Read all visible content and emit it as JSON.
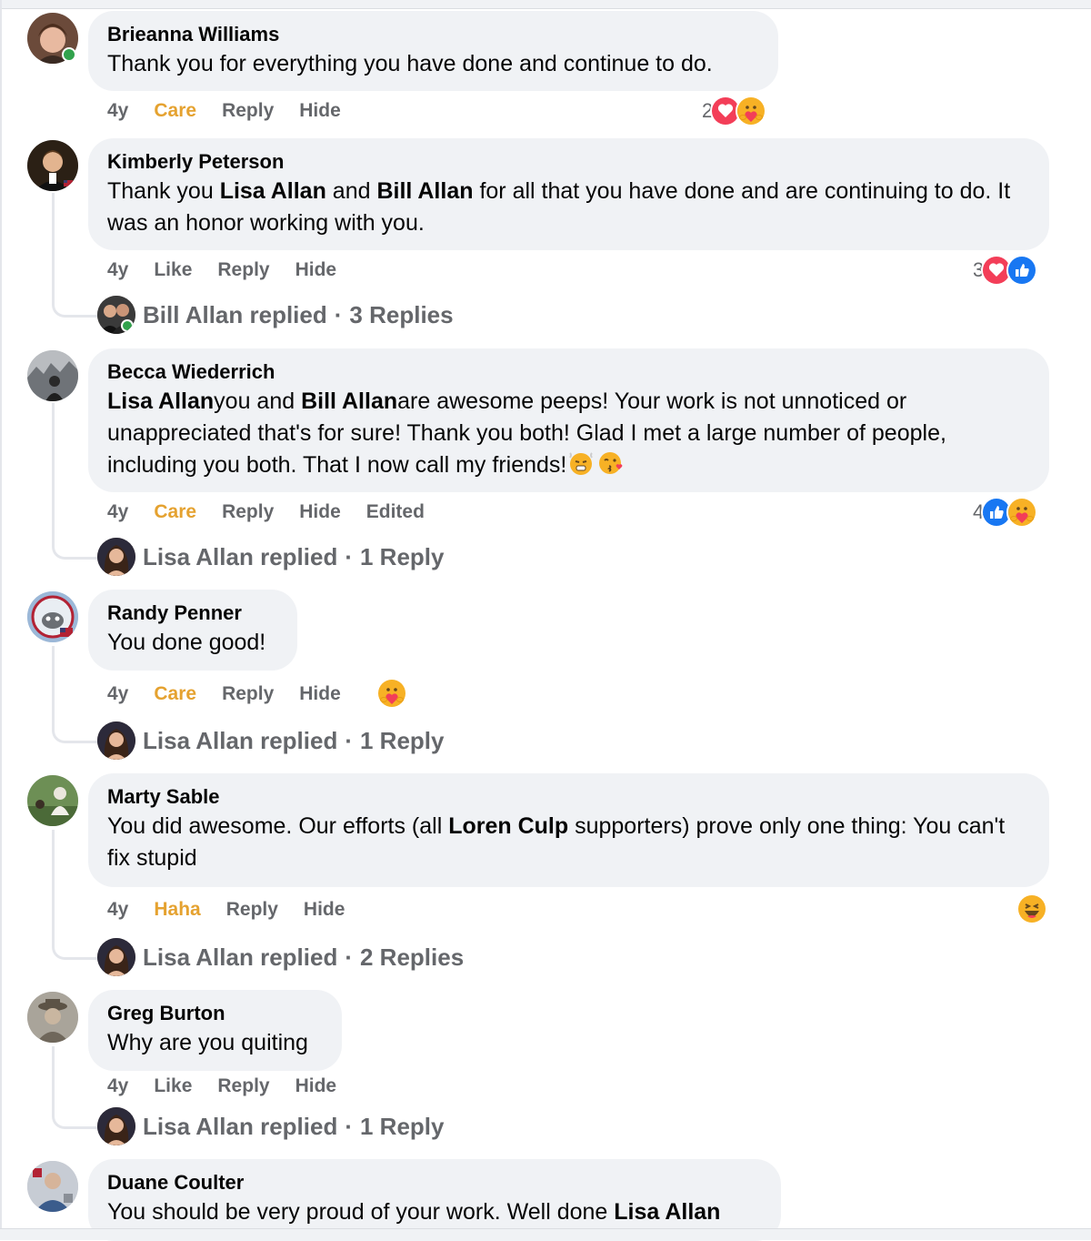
{
  "comments": [
    {
      "author": "Brieanna Williams",
      "text_parts": [
        "Thank you for everything you have done and continue to do."
      ],
      "time": "4y",
      "reaction_label": "Care",
      "reply_label": "Reply",
      "hide_label": "Hide",
      "reaction_count": "2",
      "reaction_icons": [
        "love-icon",
        "care-icon"
      ]
    },
    {
      "author": "Kimberly Peterson",
      "text_parts": [
        "Thank you ",
        "Lisa Allan",
        " and ",
        "Bill Allan",
        " for all that you have done and are continuing to do. It was an honor working with you."
      ],
      "time": "4y",
      "reaction_label": "Like",
      "reply_label": "Reply",
      "hide_label": "Hide",
      "reaction_count": "3",
      "reaction_icons": [
        "love-icon",
        "like-icon"
      ],
      "replied": {
        "who": "Bill Allan replied",
        "sep": "·",
        "count": "3 Replies"
      }
    },
    {
      "author": "Becca Wiederrich",
      "text_parts": [
        "Lisa Allan",
        "you and ",
        "Bill Allan",
        "are awesome peeps! Your work is not unnoticed or unappreciated that's for sure! Thank you both! Glad I met a large number of people, including you both. That I now call my friends!"
      ],
      "time": "4y",
      "reaction_label": "Care",
      "reply_label": "Reply",
      "hide_label": "Hide",
      "edited_label": "Edited",
      "reaction_count": "4",
      "reaction_icons": [
        "like-icon",
        "care-icon"
      ],
      "replied": {
        "who": "Lisa Allan replied",
        "sep": "·",
        "count": "1 Reply"
      }
    },
    {
      "author": "Randy Penner",
      "text_parts": [
        "You done good!"
      ],
      "time": "4y",
      "reaction_label": "Care",
      "reply_label": "Reply",
      "hide_label": "Hide",
      "reaction_icons": [
        "care-icon"
      ],
      "replied": {
        "who": "Lisa Allan replied",
        "sep": "·",
        "count": "1 Reply"
      }
    },
    {
      "author": "Marty Sable",
      "text_parts": [
        "You did awesome. Our efforts (all ",
        "Loren Culp",
        " supporters) prove only one thing: You can't fix stupid"
      ],
      "time": "4y",
      "reaction_label": "Haha",
      "reply_label": "Reply",
      "hide_label": "Hide",
      "reaction_icons": [
        "haha-icon"
      ],
      "replied": {
        "who": "Lisa Allan replied",
        "sep": "·",
        "count": "2 Replies"
      }
    },
    {
      "author": "Greg Burton",
      "text_parts": [
        "Why are you quiting"
      ],
      "time": "4y",
      "reaction_label": "Like",
      "reply_label": "Reply",
      "hide_label": "Hide",
      "replied": {
        "who": "Lisa Allan replied",
        "sep": "·",
        "count": "1 Reply"
      }
    },
    {
      "author": "Duane Coulter",
      "text_parts": [
        "You should be very proud of your work. Well done ",
        "Lisa Allan"
      ]
    }
  ],
  "colors": {
    "bubble": "#f0f2f5",
    "meta_text": "#65676b",
    "care_yellow": "#e5a230",
    "online_green": "#31a24c",
    "like_blue": "#1877f2",
    "love_red": "#f33e58"
  }
}
